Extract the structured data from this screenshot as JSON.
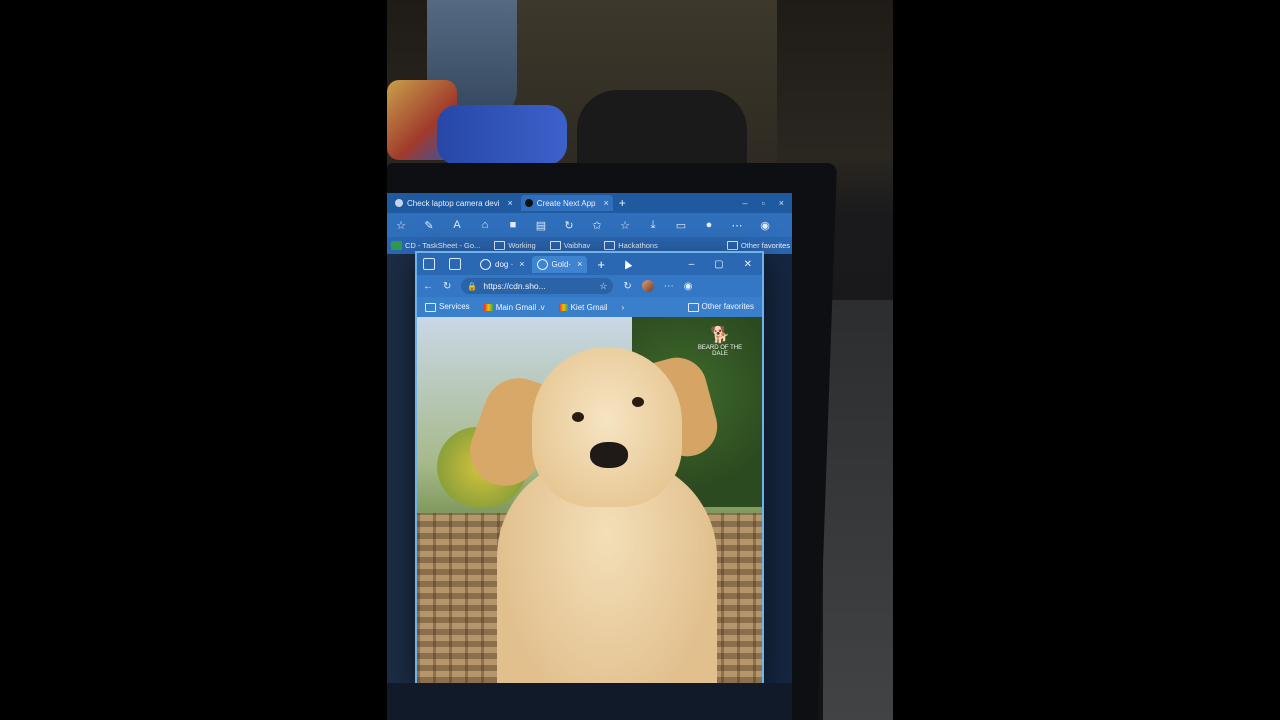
{
  "outer_browser": {
    "tabs": [
      {
        "label": "Check laptop camera devi",
        "active": false
      },
      {
        "label": "Create Next App",
        "active": true
      }
    ],
    "favorites": [
      "CD - TaskSheet - Go...",
      "Working",
      "Vaibhav",
      "Hackathons"
    ],
    "other_favorites": "Other favorites"
  },
  "inner_browser": {
    "tabs": [
      {
        "label": "dog ·",
        "active": false
      },
      {
        "label": "Gold·",
        "active": true
      }
    ],
    "address": "https://cdn.sho...",
    "favorites": [
      "Services",
      "Main Gmail .v",
      "Kiet Gmail"
    ],
    "other_favorites": "Other favorites",
    "image_watermark": "BEARD OF THE DALE"
  },
  "colors": {
    "edge_tab_blue": "#2f6fbb",
    "frame_highlight": "#6fb3ea"
  }
}
